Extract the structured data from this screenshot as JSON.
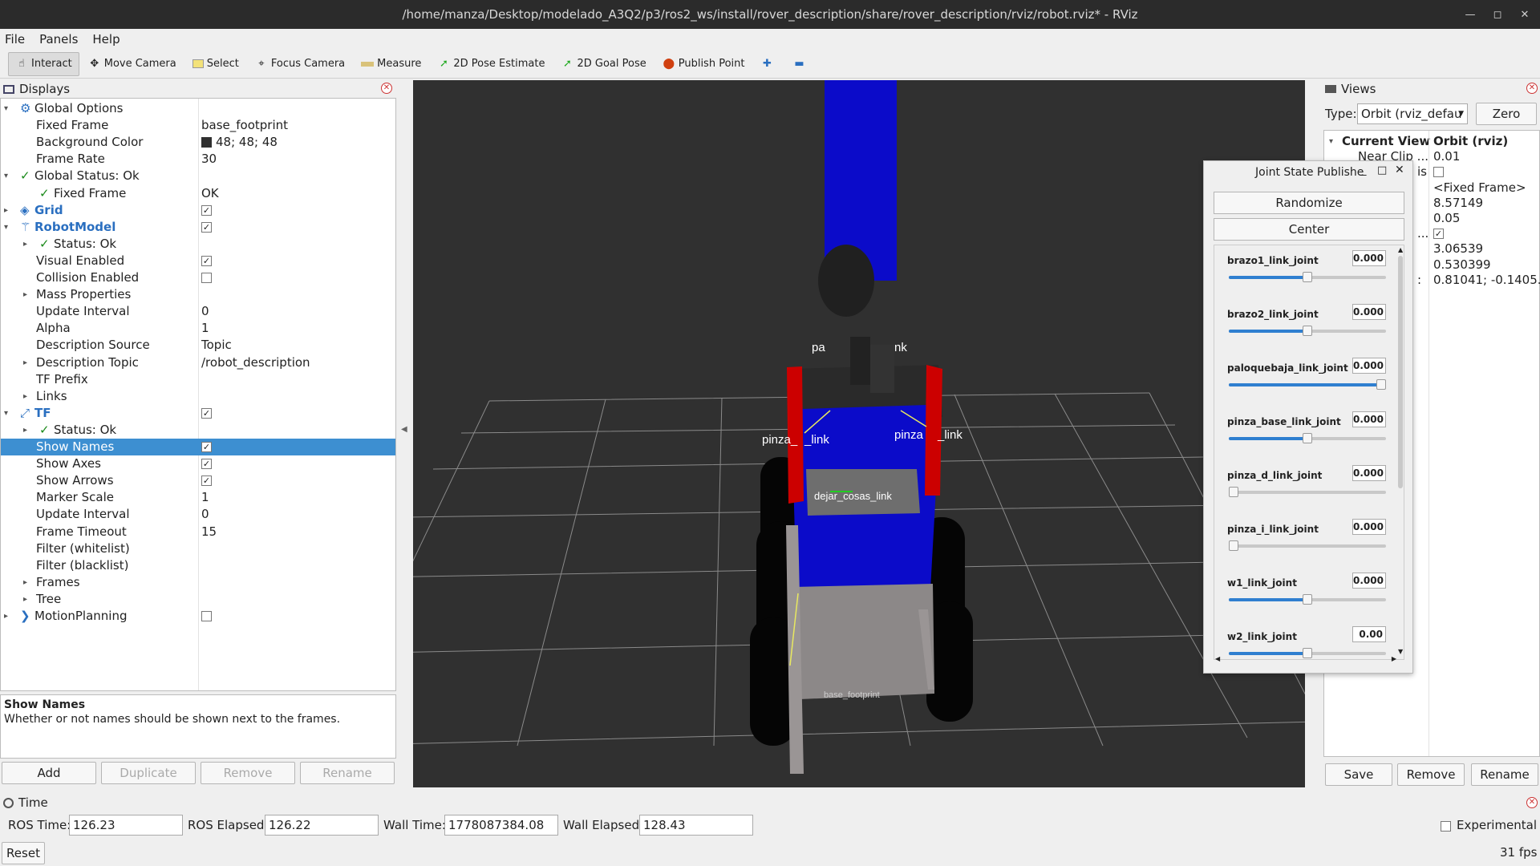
{
  "window": {
    "title": "/home/manza/Desktop/modelado_A3Q2/p3/ros2_ws/install/rover_description/share/rover_description/rviz/robot.rviz* - RViz"
  },
  "menu": [
    "File",
    "Panels",
    "Help"
  ],
  "toolbar": [
    "Interact",
    "Move Camera",
    "Select",
    "Focus Camera",
    "Measure",
    "2D Pose Estimate",
    "2D Goal Pose",
    "Publish Point"
  ],
  "displays": {
    "title": "Displays",
    "rows": [
      {
        "name": "Global Options",
        "value": ""
      },
      {
        "name": "Fixed Frame",
        "value": "base_footprint"
      },
      {
        "name": "Background Color",
        "value": "48; 48; 48"
      },
      {
        "name": "Frame Rate",
        "value": "30"
      },
      {
        "name": "Global Status: Ok",
        "value": ""
      },
      {
        "name": "Fixed Frame",
        "value": "OK"
      },
      {
        "name": "Grid",
        "value": ""
      },
      {
        "name": "RobotModel",
        "value": ""
      },
      {
        "name": "Status: Ok",
        "value": ""
      },
      {
        "name": "Visual Enabled",
        "value": ""
      },
      {
        "name": "Collision Enabled",
        "value": ""
      },
      {
        "name": "Mass Properties",
        "value": ""
      },
      {
        "name": "Update Interval",
        "value": "0"
      },
      {
        "name": "Alpha",
        "value": "1"
      },
      {
        "name": "Description Source",
        "value": "Topic"
      },
      {
        "name": "Description Topic",
        "value": "/robot_description"
      },
      {
        "name": "TF Prefix",
        "value": ""
      },
      {
        "name": "Links",
        "value": ""
      },
      {
        "name": "TF",
        "value": ""
      },
      {
        "name": "Status: Ok",
        "value": ""
      },
      {
        "name": "Show Names",
        "value": ""
      },
      {
        "name": "Show Axes",
        "value": ""
      },
      {
        "name": "Show Arrows",
        "value": ""
      },
      {
        "name": "Marker Scale",
        "value": "1"
      },
      {
        "name": "Update Interval",
        "value": "0"
      },
      {
        "name": "Frame Timeout",
        "value": "15"
      },
      {
        "name": "Filter (whitelist)",
        "value": ""
      },
      {
        "name": "Filter (blacklist)",
        "value": ""
      },
      {
        "name": "Frames",
        "value": ""
      },
      {
        "name": "Tree",
        "value": ""
      },
      {
        "name": "MotionPlanning",
        "value": ""
      }
    ],
    "description": {
      "title": "Show Names",
      "text": "Whether or not names should be shown next to the frames."
    },
    "buttons": [
      "Add",
      "Duplicate",
      "Remove",
      "Rename"
    ]
  },
  "scene_labels": [
    "pa",
    "nk",
    "pinza_",
    "_link",
    "pinza",
    "_link",
    "dejar_cosas_link",
    "base_footprint"
  ],
  "views": {
    "title": "Views",
    "type_label": "Type:",
    "type_value": "Orbit (rviz_defau",
    "zero": "Zero",
    "rows": [
      {
        "name": "Current View",
        "value": "Orbit (rviz)"
      },
      {
        "name": "Near Clip ...",
        "value": "0.01"
      },
      {
        "name": "is",
        "value": ""
      },
      {
        "name": "",
        "value": "<Fixed Frame>"
      },
      {
        "name": "",
        "value": "8.57149"
      },
      {
        "name": "",
        "value": "0.05"
      },
      {
        "name": "...",
        "value": ""
      },
      {
        "name": "",
        "value": "3.06539"
      },
      {
        "name": "",
        "value": "0.530399"
      },
      {
        "name": ":",
        "value": "0.81041; -0.1405..."
      }
    ],
    "buttons": [
      "Save",
      "Remove",
      "Rename"
    ]
  },
  "jsp": {
    "title": "Joint State Publishe",
    "randomize": "Randomize",
    "center": "Center",
    "joints": [
      {
        "name": "brazo1_link_joint",
        "value": "0.000",
        "level": 0.5
      },
      {
        "name": "brazo2_link_joint",
        "value": "0.000",
        "level": 0.5
      },
      {
        "name": "paloquebaja_link_joint",
        "value": "0.000",
        "level": 1.0
      },
      {
        "name": "pinza_base_link_joint",
        "value": "0.000",
        "level": 0.5
      },
      {
        "name": "pinza_d_link_joint",
        "value": "0.000",
        "level": 0.0
      },
      {
        "name": "pinza_i_link_joint",
        "value": "0.000",
        "level": 0.0
      },
      {
        "name": "w1_link_joint",
        "value": "0.000",
        "level": 0.5
      },
      {
        "name": "w2_link_joint",
        "value": "0.00",
        "level": 0.5
      }
    ]
  },
  "time": {
    "title": "Time",
    "ros_time_label": "ROS Time:",
    "ros_time": "126.23",
    "ros_elapsed_label": "ROS Elapsed:",
    "ros_elapsed": "126.22",
    "wall_time_label": "Wall Time:",
    "wall_time": "1778087384.08",
    "wall_elapsed_label": "Wall Elapsed:",
    "wall_elapsed": "128.43",
    "experimental": "Experimental",
    "reset": "Reset",
    "fps": "31 fps"
  }
}
